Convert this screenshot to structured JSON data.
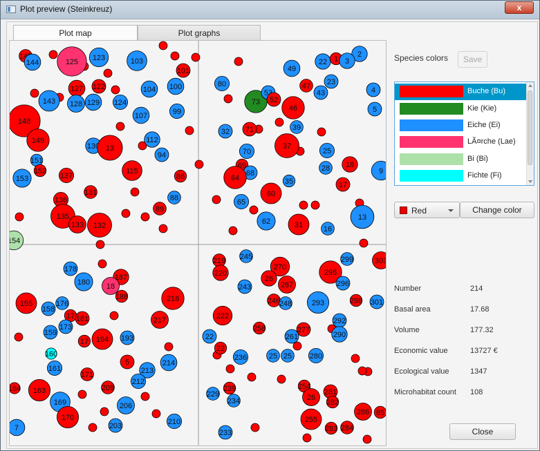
{
  "window": {
    "title": "Plot preview (Steinkreuz)",
    "close_label": "x"
  },
  "tabs": [
    {
      "label": "Plot map",
      "active": true
    },
    {
      "label": "Plot graphs",
      "active": false
    }
  ],
  "side": {
    "species_colors_label": "Species colors",
    "save_label": "Save",
    "species": [
      {
        "name": "Buche (Bu)",
        "color": "#ff0000",
        "selected": true
      },
      {
        "name": "Kie (Kie)",
        "color": "#228b22",
        "selected": false
      },
      {
        "name": "Eiche (Ei)",
        "color": "#1e90ff",
        "selected": false
      },
      {
        "name": "LÃ¤rche (Lae)",
        "color": "#ff3370",
        "selected": false
      },
      {
        "name": "Bi (Bi)",
        "color": "#aee0aa",
        "selected": false
      },
      {
        "name": "Fichte (Fi)",
        "color": "#00ffff",
        "selected": false
      }
    ],
    "color_select_value": "Red",
    "color_select_swatch": "#e60000",
    "change_color_label": "Change color",
    "stats": [
      {
        "label": "Number",
        "value": "214"
      },
      {
        "label": "Basal area",
        "value": "17.68"
      },
      {
        "label": "Volume",
        "value": "177.32"
      },
      {
        "label": "Economic value",
        "value": "13727 €"
      },
      {
        "label": "Ecological value",
        "value": "1347"
      },
      {
        "label": "Microhabitat count",
        "value": "108"
      }
    ],
    "close_label": "Close"
  },
  "map": {
    "species_colors": {
      "Bu": "#ff0000",
      "Kie": "#228b22",
      "Ei": "#1e90ff",
      "Lae": "#ff3370",
      "Bi": "#aee0aa",
      "Fi": "#00ffff"
    },
    "trees": [
      {
        "id": "145",
        "sp": "Bu",
        "d": 15
      },
      {
        "id": "144",
        "sp": "Ei",
        "d": 19
      },
      {
        "id": "125",
        "sp": "Lae",
        "d": 34
      },
      {
        "id": "123",
        "sp": "Ei",
        "d": 22
      },
      {
        "id": "103",
        "sp": "Ei",
        "d": 23
      },
      {
        "id": "101",
        "sp": "Bu",
        "d": 16
      },
      {
        "id": "127",
        "sp": "Bu",
        "d": 19
      },
      {
        "id": "122",
        "sp": "Bu",
        "d": 16
      },
      {
        "id": "100",
        "sp": "Ei",
        "d": 19
      },
      {
        "id": "104",
        "sp": "Ei",
        "d": 19
      },
      {
        "id": "143",
        "sp": "Ei",
        "d": 24
      },
      {
        "id": "128",
        "sp": "Ei",
        "d": 20
      },
      {
        "id": "129",
        "sp": "Ei",
        "d": 19
      },
      {
        "id": "124",
        "sp": "Ei",
        "d": 17
      },
      {
        "id": "99",
        "sp": "Ei",
        "d": 17
      },
      {
        "id": "107",
        "sp": "Ei",
        "d": 19
      },
      {
        "id": "148",
        "sp": "Bu",
        "d": 37
      },
      {
        "id": "149",
        "sp": "Bu",
        "d": 26
      },
      {
        "id": "130",
        "sp": "Ei",
        "d": 18
      },
      {
        "id": "13",
        "sp": "Bu",
        "d": 29
      },
      {
        "id": "112",
        "sp": "Ei",
        "d": 18
      },
      {
        "id": "94",
        "sp": "Ei",
        "d": 16
      },
      {
        "id": "151",
        "sp": "Ei",
        "d": 14
      },
      {
        "id": "152",
        "sp": "Bu",
        "d": 14
      },
      {
        "id": "153",
        "sp": "Ei",
        "d": 21
      },
      {
        "id": "137",
        "sp": "Bu",
        "d": 17
      },
      {
        "id": "115",
        "sp": "Bu",
        "d": 23
      },
      {
        "id": "86",
        "sp": "Bu",
        "d": 14
      },
      {
        "id": "131",
        "sp": "Bu",
        "d": 15
      },
      {
        "id": "88",
        "sp": "Ei",
        "d": 15
      },
      {
        "id": "136",
        "sp": "Bu",
        "d": 17
      },
      {
        "id": "135",
        "sp": "Bu",
        "d": 28
      },
      {
        "id": "89",
        "sp": "Bu",
        "d": 15
      },
      {
        "id": "133",
        "sp": "Bu",
        "d": 20
      },
      {
        "id": "132",
        "sp": "Bu",
        "d": 28
      },
      {
        "id": "154",
        "sp": "Bi",
        "d": 22
      },
      {
        "id": "2",
        "sp": "Ei",
        "d": 18
      },
      {
        "id": "22",
        "sp": "Ei",
        "d": 18
      },
      {
        "id": "1",
        "sp": "Bu",
        "d": 14
      },
      {
        "id": "3",
        "sp": "Ei",
        "d": 18
      },
      {
        "id": "49",
        "sp": "Ei",
        "d": 19
      },
      {
        "id": "80",
        "sp": "Ei",
        "d": 17
      },
      {
        "id": "23",
        "sp": "Ei",
        "d": 16
      },
      {
        "id": "4",
        "sp": "Ei",
        "d": 16
      },
      {
        "id": "47",
        "sp": "Bu",
        "d": 15
      },
      {
        "id": "43",
        "sp": "Ei",
        "d": 16
      },
      {
        "id": "73",
        "sp": "Kie",
        "d": 26
      },
      {
        "id": "53",
        "sp": "Ei",
        "d": 16
      },
      {
        "id": "52",
        "sp": "Bu",
        "d": 16
      },
      {
        "id": "46",
        "sp": "Bu",
        "d": 26
      },
      {
        "id": "5",
        "sp": "Ei",
        "d": 16
      },
      {
        "id": "39",
        "sp": "Ei",
        "d": 15
      },
      {
        "id": "32",
        "sp": "Ei",
        "d": 16
      },
      {
        "id": "71",
        "sp": "Bu",
        "d": 16
      },
      {
        "id": "37",
        "sp": "Bu",
        "d": 28
      },
      {
        "id": "70",
        "sp": "Ei",
        "d": 17
      },
      {
        "id": "25",
        "sp": "Ei",
        "d": 17
      },
      {
        "id": "69",
        "sp": "Bu",
        "d": 14
      },
      {
        "id": "68",
        "sp": "Ei",
        "d": 16
      },
      {
        "id": "28",
        "sp": "Ei",
        "d": 15
      },
      {
        "id": "18",
        "sp": "Bu",
        "d": 18
      },
      {
        "id": "9",
        "sp": "Ei",
        "d": 22
      },
      {
        "id": "64",
        "sp": "Bu",
        "d": 26
      },
      {
        "id": "35",
        "sp": "Ei",
        "d": 14
      },
      {
        "id": "17",
        "sp": "Bu",
        "d": 16
      },
      {
        "id": "60",
        "sp": "Bu",
        "d": 24
      },
      {
        "id": "65",
        "sp": "Ei",
        "d": 17
      },
      {
        "id": "13",
        "sp": "Ei",
        "d": 27
      },
      {
        "id": "62",
        "sp": "Ei",
        "d": 21
      },
      {
        "id": "31",
        "sp": "Bu",
        "d": 24
      },
      {
        "id": "16",
        "sp": "Ei",
        "d": 15
      },
      {
        "id": "178",
        "sp": "Ei",
        "d": 16
      },
      {
        "id": "180",
        "sp": "Ei",
        "d": 21
      },
      {
        "id": "187",
        "sp": "Bu",
        "d": 18
      },
      {
        "id": "18",
        "sp": "Lae",
        "d": 20
      },
      {
        "id": "188",
        "sp": "Bu",
        "d": 14
      },
      {
        "id": "155",
        "sp": "Bu",
        "d": 24
      },
      {
        "id": "176",
        "sp": "Ei",
        "d": 15
      },
      {
        "id": "158",
        "sp": "Ei",
        "d": 16
      },
      {
        "id": "17",
        "sp": "Bu",
        "d": 14
      },
      {
        "id": "181",
        "sp": "Bu",
        "d": 16
      },
      {
        "id": "173",
        "sp": "Ei",
        "d": 16
      },
      {
        "id": "218",
        "sp": "Bu",
        "d": 26
      },
      {
        "id": "217",
        "sp": "Bu",
        "d": 20
      },
      {
        "id": "159",
        "sp": "Ei",
        "d": 16
      },
      {
        "id": "17",
        "sp": "Bu",
        "d": 14
      },
      {
        "id": "194",
        "sp": "Bu",
        "d": 24
      },
      {
        "id": "193",
        "sp": "Ei",
        "d": 16
      },
      {
        "id": "160",
        "sp": "Fi",
        "d": 13
      },
      {
        "id": "161",
        "sp": "Ei",
        "d": 17
      },
      {
        "id": "5",
        "sp": "Bu",
        "d": 16
      },
      {
        "id": "214",
        "sp": "Ei",
        "d": 19
      },
      {
        "id": "213",
        "sp": "Ei",
        "d": 18
      },
      {
        "id": "171",
        "sp": "Bu",
        "d": 15
      },
      {
        "id": "212",
        "sp": "Ei",
        "d": 17
      },
      {
        "id": "164",
        "sp": "Bu",
        "d": 13
      },
      {
        "id": "163",
        "sp": "Bu",
        "d": 25
      },
      {
        "id": "209",
        "sp": "Bu",
        "d": 15
      },
      {
        "id": "169",
        "sp": "Ei",
        "d": 23
      },
      {
        "id": "206",
        "sp": "Ei",
        "d": 20
      },
      {
        "id": "170",
        "sp": "Bu",
        "d": 25
      },
      {
        "id": "210",
        "sp": "Ei",
        "d": 17
      },
      {
        "id": "7",
        "sp": "Ei",
        "d": 19
      },
      {
        "id": "203",
        "sp": "Ei",
        "d": 16
      },
      {
        "id": "219",
        "sp": "Bu",
        "d": 15
      },
      {
        "id": "245",
        "sp": "Ei",
        "d": 15
      },
      {
        "id": "220",
        "sp": "Bu",
        "d": 18
      },
      {
        "id": "270",
        "sp": "Bu",
        "d": 22
      },
      {
        "id": "295",
        "sp": "Bu",
        "d": 26
      },
      {
        "id": "299",
        "sp": "Ei",
        "d": 15
      },
      {
        "id": "303",
        "sp": "Bu",
        "d": 20
      },
      {
        "id": "243",
        "sp": "Ei",
        "d": 16
      },
      {
        "id": "26",
        "sp": "Bu",
        "d": 18
      },
      {
        "id": "267",
        "sp": "Bu",
        "d": 20
      },
      {
        "id": "296",
        "sp": "Ei",
        "d": 16
      },
      {
        "id": "246",
        "sp": "Bu",
        "d": 15
      },
      {
        "id": "293",
        "sp": "Ei",
        "d": 25
      },
      {
        "id": "298",
        "sp": "Bu",
        "d": 14
      },
      {
        "id": "301",
        "sp": "Ei",
        "d": 16
      },
      {
        "id": "248",
        "sp": "Ei",
        "d": 15
      },
      {
        "id": "222",
        "sp": "Bu",
        "d": 22
      },
      {
        "id": "258",
        "sp": "Bu",
        "d": 14
      },
      {
        "id": "292",
        "sp": "Ei",
        "d": 16
      },
      {
        "id": "277",
        "sp": "Bu",
        "d": 16
      },
      {
        "id": "261",
        "sp": "Ei",
        "d": 16
      },
      {
        "id": "290",
        "sp": "Ei",
        "d": 18
      },
      {
        "id": "22",
        "sp": "Ei",
        "d": 16
      },
      {
        "id": "22",
        "sp": "Bu",
        "d": 14
      },
      {
        "id": "236",
        "sp": "Ei",
        "d": 17
      },
      {
        "id": "25",
        "sp": "Ei",
        "d": 15
      },
      {
        "id": "25",
        "sp": "Ei",
        "d": 15
      },
      {
        "id": "280",
        "sp": "Ei",
        "d": 17
      },
      {
        "id": "254",
        "sp": "Bu",
        "d": 14
      },
      {
        "id": "239",
        "sp": "Bu",
        "d": 14
      },
      {
        "id": "281",
        "sp": "Bu",
        "d": 16
      },
      {
        "id": "229",
        "sp": "Ei",
        "d": 15
      },
      {
        "id": "234",
        "sp": "Ei",
        "d": 15
      },
      {
        "id": "26",
        "sp": "Bu",
        "d": 20
      },
      {
        "id": "282",
        "sp": "Bu",
        "d": 14
      },
      {
        "id": "286",
        "sp": "Bu",
        "d": 20
      },
      {
        "id": "85",
        "sp": "Bu",
        "d": 14
      },
      {
        "id": "255",
        "sp": "Bu",
        "d": 24
      },
      {
        "id": "283",
        "sp": "Bu",
        "d": 14
      },
      {
        "id": "284",
        "sp": "Bu",
        "d": 15
      },
      {
        "id": "233",
        "sp": "Ei",
        "d": 16
      }
    ]
  }
}
